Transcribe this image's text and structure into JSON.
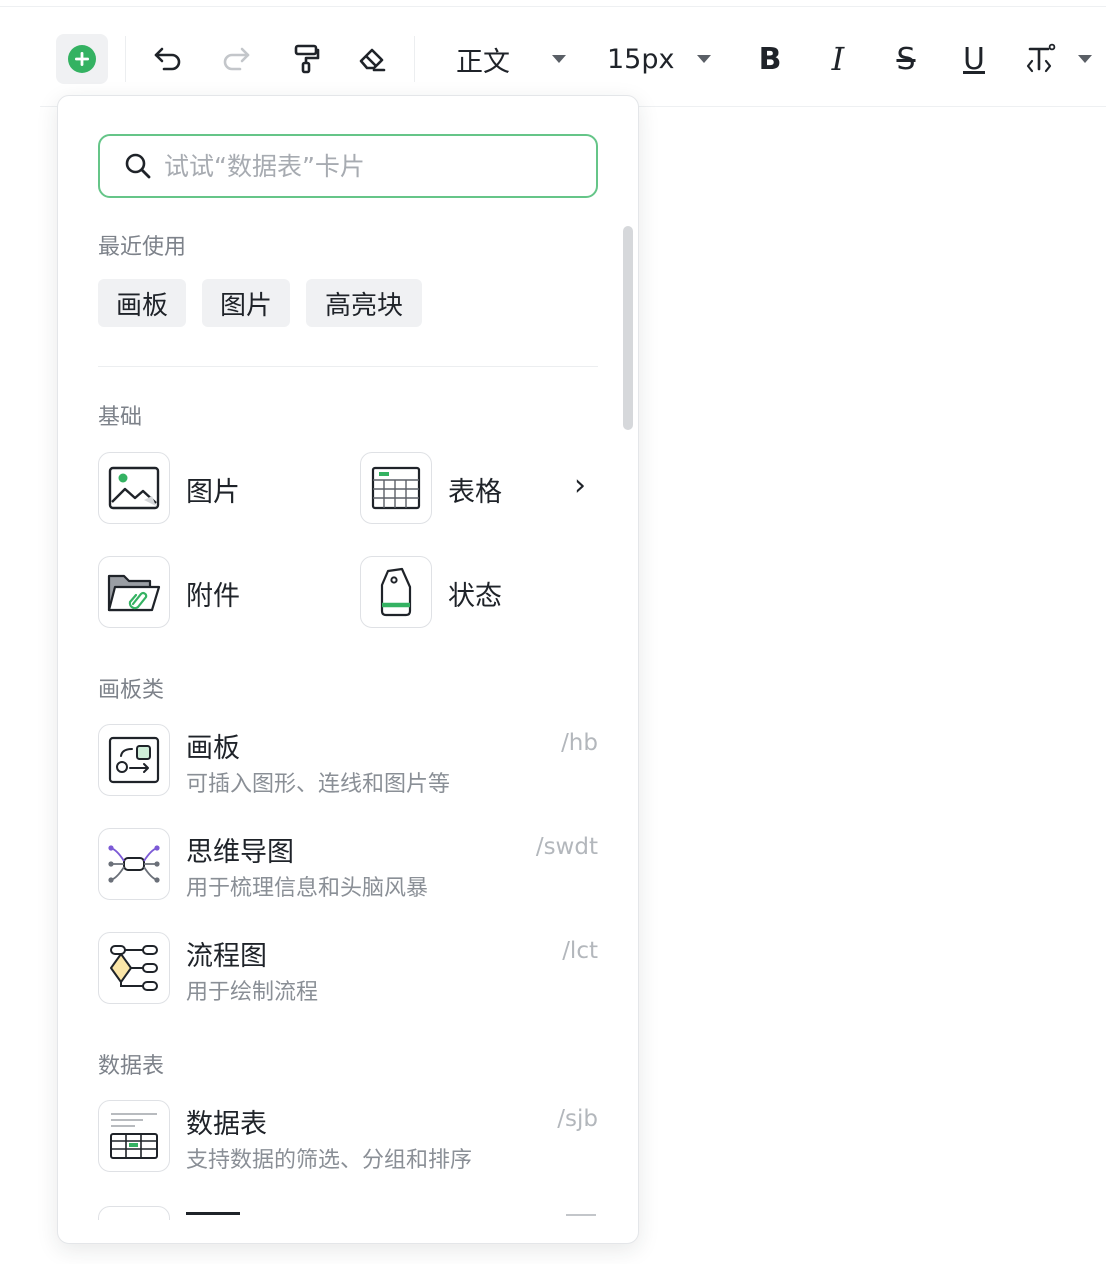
{
  "toolbar": {
    "undo_icon": "undo-icon",
    "redo_icon": "redo-icon",
    "format_painter_icon": "format-painter-icon",
    "eraser_icon": "eraser-icon",
    "paragraph_style": "正文",
    "font_size": "15px",
    "bold_label": "B",
    "italic_label": "I",
    "strike_label": "S",
    "underline_label": "U",
    "accent_color": "#34b262"
  },
  "panel": {
    "search": {
      "placeholder": "试试“数据表”卡片"
    },
    "recent": {
      "title": "最近使用",
      "chips": [
        "画板",
        "图片",
        "高亮块"
      ]
    },
    "basic": {
      "title": "基础",
      "items": [
        "图片",
        "表格",
        "附件",
        "状态"
      ],
      "table_chevron": "›"
    },
    "board_section": {
      "title": "画板类",
      "items": [
        {
          "title": "画板",
          "desc": "可插入图形、连线和图片等",
          "shortcut": "/hb"
        },
        {
          "title": "思维导图",
          "desc": "用于梳理信息和头脑风暴",
          "shortcut": "/swdt"
        },
        {
          "title": "流程图",
          "desc": "用于绘制流程",
          "shortcut": "/lct"
        }
      ]
    },
    "data_section": {
      "title": "数据表",
      "items": [
        {
          "title": "数据表",
          "desc": "支持数据的筛选、分组和排序",
          "shortcut": "/sjb"
        }
      ]
    }
  }
}
